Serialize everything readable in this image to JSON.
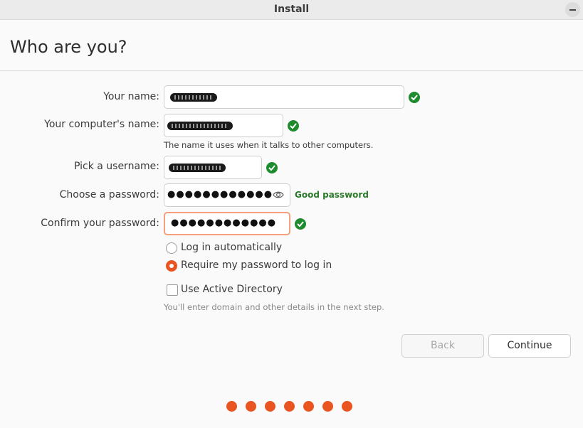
{
  "window": {
    "title": "Install"
  },
  "page": {
    "heading": "Who are you?"
  },
  "form": {
    "name_label": "Your name:",
    "computer_label": "Your computer's name:",
    "computer_hint": "The name it uses when it talks to other computers.",
    "username_label": "Pick a username:",
    "password_label": "Choose a password:",
    "password_value": "●●●●●●●●●●●●",
    "password_strength": "Good password",
    "confirm_label": "Confirm your password:",
    "confirm_value": "●●●●●●●●●●●●"
  },
  "options": {
    "auto_login": "Log in automatically",
    "require_password": "Require my password to log in",
    "selected": "require_password",
    "active_directory": "Use Active Directory",
    "active_directory_checked": false,
    "active_directory_hint": "You'll enter domain and other details in the next step."
  },
  "buttons": {
    "back": "Back",
    "continue": "Continue"
  },
  "progress": {
    "total_steps": 7
  },
  "colors": {
    "accent": "#e95420",
    "valid": "#1f8b2f",
    "good_password": "#2a7a2a"
  }
}
